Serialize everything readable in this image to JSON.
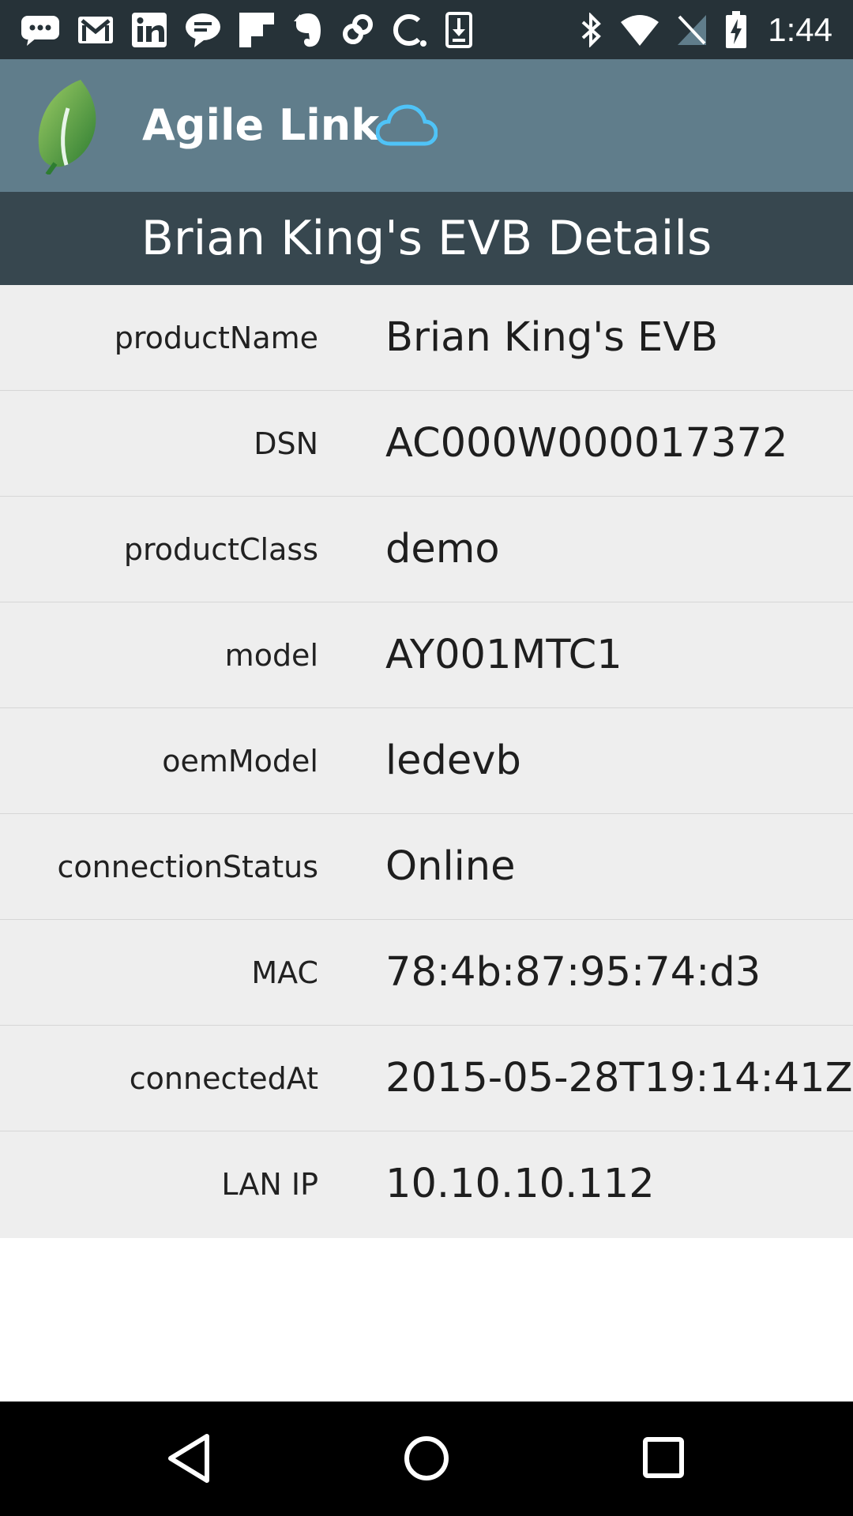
{
  "status_bar": {
    "time": "1:44",
    "notification_icons": [
      "message-icon",
      "gmail-icon",
      "linkedin-icon",
      "hangouts-icon",
      "flipboard-icon",
      "evernote-icon",
      "link-icon",
      "c-icon",
      "download-icon"
    ],
    "system_icons": [
      "bluetooth-icon",
      "wifi-icon",
      "no-sim-icon",
      "battery-charging-icon"
    ]
  },
  "app_bar": {
    "title": "Agile Link",
    "logo": "leaf-logo",
    "cloud_icon": "cloud-icon",
    "accent_color": "#4fc3f7"
  },
  "header": {
    "title": "Brian King's EVB Details"
  },
  "details": [
    {
      "key": "productName",
      "value": "Brian King's EVB"
    },
    {
      "key": "DSN",
      "value": "AC000W000017372"
    },
    {
      "key": "productClass",
      "value": "demo"
    },
    {
      "key": "model",
      "value": "AY001MTC1"
    },
    {
      "key": "oemModel",
      "value": "ledevb"
    },
    {
      "key": "connectionStatus",
      "value": "Online"
    },
    {
      "key": "MAC",
      "value": "78:4b:87:95:74:d3"
    },
    {
      "key": "connectedAt",
      "value": "2015-05-28T19:14:41Z"
    },
    {
      "key": "LAN IP",
      "value": "10.10.10.112"
    }
  ],
  "nav_bar": {
    "buttons": [
      "back-icon",
      "home-icon",
      "recents-icon"
    ]
  },
  "colors": {
    "status_bar": "#263238",
    "app_bar": "#607d8b",
    "section_header": "#37474f",
    "list_background": "#eeeeee"
  }
}
